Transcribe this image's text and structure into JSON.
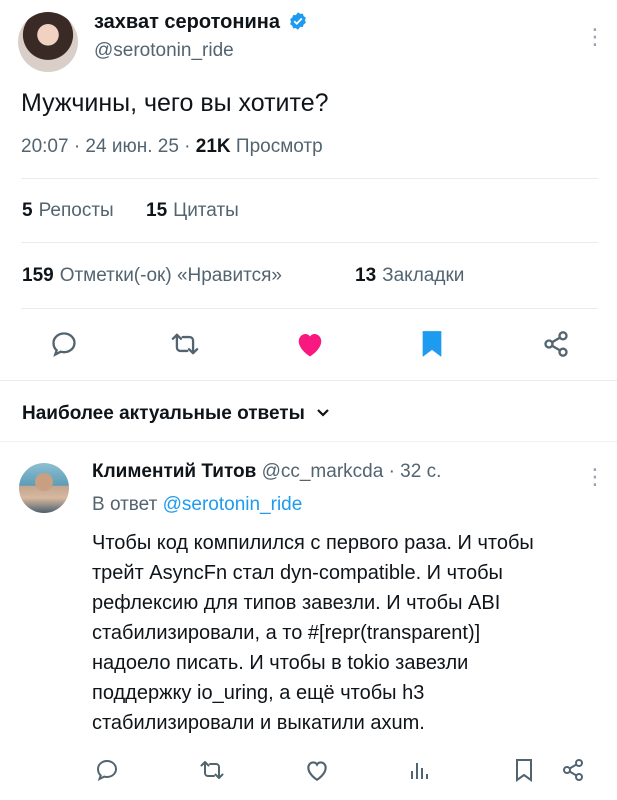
{
  "tweet": {
    "author_name": "захват серотонина",
    "author_handle": "@serotonin_ride",
    "text": "Мужчины, чего вы хотите?",
    "time": "20:07 · 24 июн. 25 ·",
    "views_count": "21K",
    "views_label": "Просмотр",
    "more": "⋮"
  },
  "stats": {
    "reposts_count": "5",
    "reposts_label": "Репосты",
    "quotes_count": "15",
    "quotes_label": "Цитаты",
    "likes_count": "159",
    "likes_label": "Отметки(-ок) «Нравится»",
    "bookmarks_count": "13",
    "bookmarks_label": "Закладки"
  },
  "colors": {
    "like_active": "#f91880",
    "bookmark_active": "#1d9bf0",
    "verified": "#1d9bf0",
    "text_secondary": "#536471",
    "link": "#1d9bf0"
  },
  "actions": [
    "reply-icon",
    "retweet-icon",
    "like-icon",
    "bookmark-icon",
    "share-icon"
  ],
  "replies_section": {
    "title": "Наиболее актуальные ответы",
    "chevron": "⌄"
  },
  "reply": {
    "author_name": "Климентий Титов",
    "author_handle": "@cc_markcda",
    "time": "· 32 с.",
    "in_reply_prefix": "В ответ",
    "in_reply_handle": "@serotonin_ride",
    "more": "⋮",
    "lines": [
      "Чтобы код компилился с первого раза. И чтобы",
      "трейт AsyncFn стал dyn-compatible. И чтобы",
      "рефлексию для типов завезли. И чтобы ABI",
      "стабилизировали, а то #[repr(transparent)]",
      "надоело писать. И чтобы в tokio завезли",
      "поддержку io_uring, а ещё чтобы h3",
      "стабилизировали и выкатили axum."
    ],
    "actions": [
      "reply-icon",
      "retweet-icon",
      "like-icon",
      "views-icon",
      "bookmark-icon",
      "share-icon"
    ]
  }
}
